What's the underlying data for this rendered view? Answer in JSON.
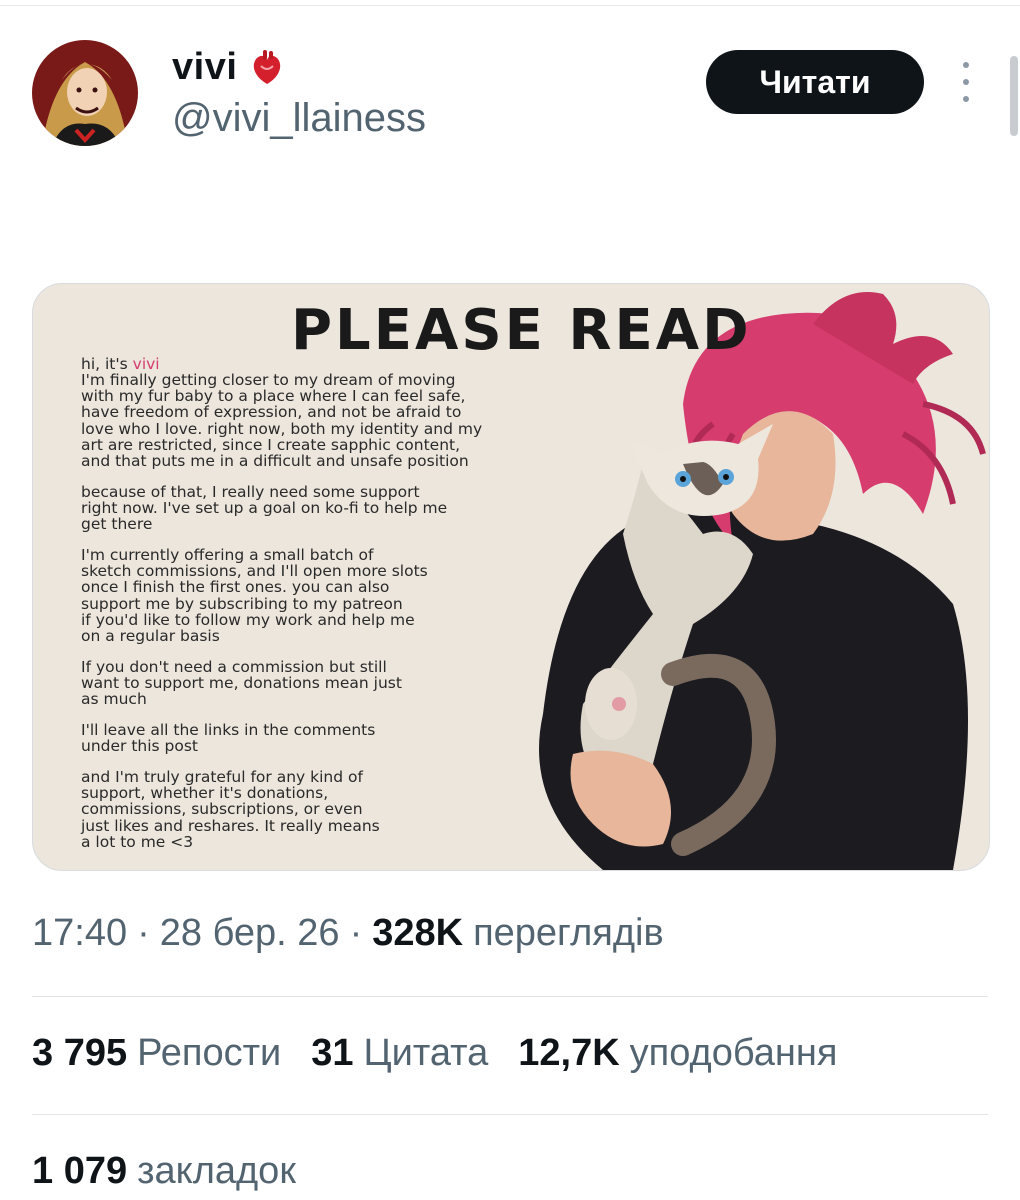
{
  "author": {
    "display_name": "vivi",
    "handle": "@vivi_llainess",
    "follow_label": "Читати"
  },
  "media": {
    "title": "PLEASE READ",
    "greeting_prefix": "hi, it's",
    "greeting_name": "vivi",
    "paragraphs": [
      "I'm finally getting closer to my dream of moving\nwith my fur baby to a place where I can feel safe,\nhave freedom of expression, and not be afraid to\nlove who I love. right now, both my identity and my\nart are restricted, since I create sapphic content,\nand that puts me in a difficult and unsafe position",
      "because of that, I really need some support\nright now. I've set up a goal on ko-fi to help me\nget there",
      "I'm currently offering a small batch of\nsketch commissions, and I'll open more slots\nonce I finish the first ones. you can also\nsupport me by subscribing to my patreon\nif you'd like to follow my work and help me\non a regular basis",
      "If you don't need a commission but still\nwant to support me, donations mean just\nas much",
      "I'll leave all the links in the comments\nunder this post",
      "and I'm truly grateful for any kind of\nsupport, whether it's donations,\ncommissions, subscriptions, or even\njust likes and reshares. It really means\na lot to me  <3"
    ]
  },
  "meta": {
    "time": "17:40",
    "date": "28 бер. 26",
    "separator": "·",
    "views_count": "328K",
    "views_label": "переглядів"
  },
  "stats": {
    "reposts_count": "3 795",
    "reposts_label": "Репости",
    "quotes_count": "31",
    "quotes_label": "Цитата",
    "likes_count": "12,7K",
    "likes_label": "уподобання",
    "bookmarks_count": "1 079",
    "bookmarks_label": "закладок"
  },
  "icons": {
    "heart": "anatomical-heart-icon",
    "more": "more-vertical-icon"
  },
  "colors": {
    "accent_dark": "#0f1419",
    "secondary_text": "#536471",
    "media_background": "#ece6dd",
    "hair": "#d63c6e"
  }
}
